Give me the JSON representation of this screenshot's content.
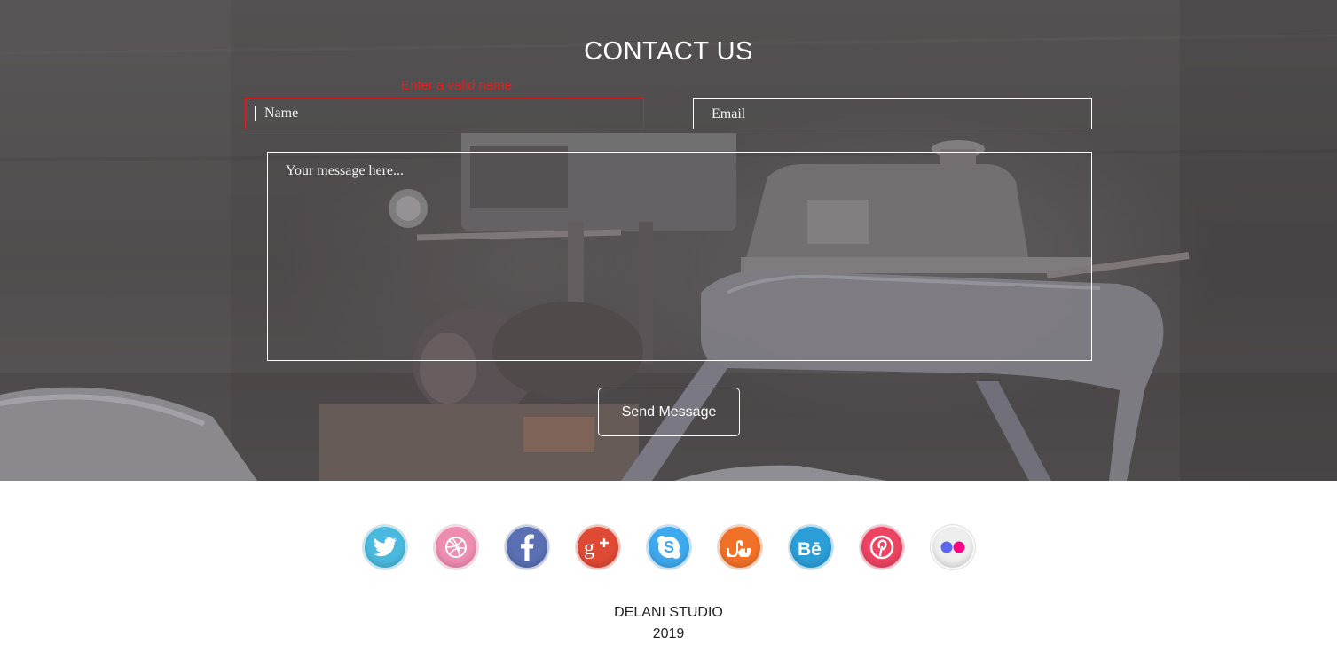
{
  "contact": {
    "title": "CONTACT US",
    "error_message": "Enter a valid name",
    "name_placeholder": "Name",
    "email_placeholder": "Email",
    "message_placeholder": "Your message here...",
    "send_label": "Send Message"
  },
  "social": [
    {
      "name": "twitter",
      "icon": "twitter-icon",
      "color": "#4ab9dd"
    },
    {
      "name": "dribbble",
      "icon": "dribbble-icon",
      "color": "#ee8db2"
    },
    {
      "name": "facebook",
      "icon": "facebook-icon",
      "color": "#5a70b3"
    },
    {
      "name": "google-plus",
      "icon": "google-plus-icon",
      "color": "#df4a35"
    },
    {
      "name": "skype",
      "icon": "skype-icon",
      "color": "#3fa9ee"
    },
    {
      "name": "stumbleupon",
      "icon": "stumbleupon-icon",
      "color": "#f27128"
    },
    {
      "name": "behance",
      "icon": "behance-icon",
      "color": "#2b9ed8"
    },
    {
      "name": "pinterest",
      "icon": "pinterest-icon",
      "color": "#ec4461"
    },
    {
      "name": "flickr",
      "icon": "flickr-icon",
      "color": "#eeeeee"
    }
  ],
  "footer": {
    "studio_name": "DELANI STUDIO",
    "year": "2019"
  },
  "colors": {
    "error": "#e0201f",
    "field_border": "#ffffff",
    "footer_text": "#222222"
  }
}
